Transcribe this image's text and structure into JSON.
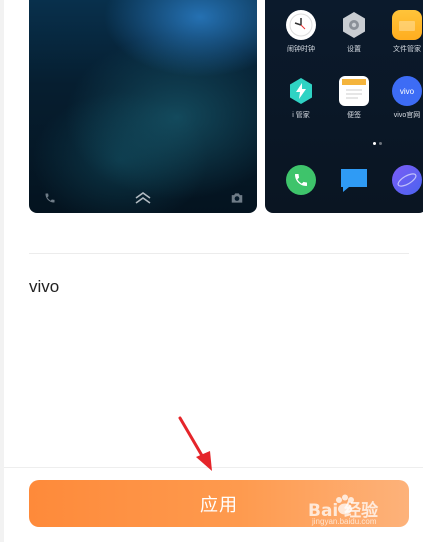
{
  "home_preview": {
    "apps": [
      {
        "label": "闹钟时钟",
        "icon": "clock-icon"
      },
      {
        "label": "设置",
        "icon": "gear-icon"
      },
      {
        "label": "文件管家",
        "icon": "folder-icon"
      },
      {
        "label": "i 管家",
        "icon": "shield-bolt-icon"
      },
      {
        "label": "便签",
        "icon": "note-icon"
      },
      {
        "label": "vivo官网",
        "icon": "vivo-logo-icon"
      }
    ],
    "dock": [
      {
        "icon": "phone-icon"
      },
      {
        "icon": "message-icon"
      },
      {
        "icon": "browser-icon"
      }
    ]
  },
  "lock_preview": {
    "icons": [
      "phone-icon",
      "chevron-up-icon",
      "camera-icon"
    ]
  },
  "theme": {
    "name": "vivo"
  },
  "actions": {
    "apply_label": "应用"
  },
  "watermark": {
    "main": "Bai  经验",
    "sub": "jingyan.baidu.com"
  },
  "colors": {
    "accent_start": "#fe8a3a",
    "accent_end": "#fdb27a",
    "arrow": "#e5252a"
  }
}
